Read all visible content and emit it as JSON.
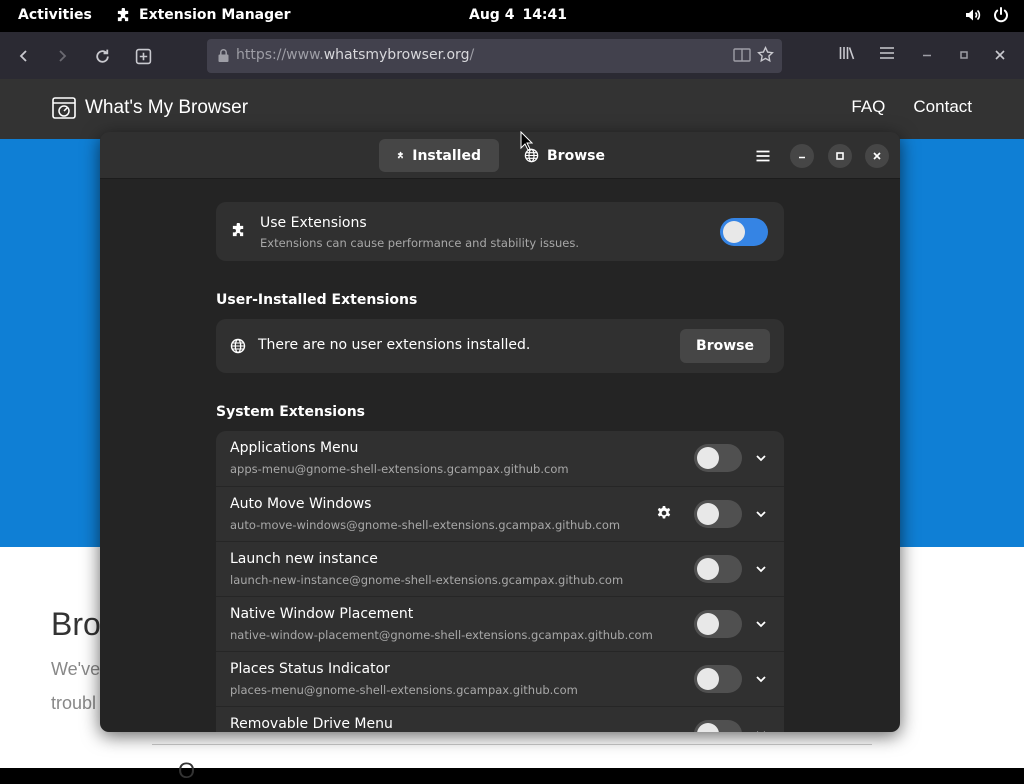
{
  "topbar": {
    "activities": "Activities",
    "app_name": "Extension Manager",
    "date": "Aug 4",
    "time": "14:41"
  },
  "browser": {
    "url_prefix": "https://www.",
    "url_domain": "whatsmybrowser.org",
    "url_suffix": "/"
  },
  "website": {
    "brand": "What's My Browser",
    "nav": [
      "FAQ",
      "Contact"
    ],
    "heading_partial": "Bro",
    "para_line1": "We've",
    "para_line2": "troubl",
    "bottom_partial": "O"
  },
  "extmgr": {
    "tabs": [
      {
        "label": "Installed",
        "icon": "puzzle-icon",
        "active": true
      },
      {
        "label": "Browse",
        "icon": "globe-icon",
        "active": false
      }
    ],
    "use_extensions": {
      "title": "Use Extensions",
      "subtitle": "Extensions can cause performance and stability issues.",
      "enabled": true
    },
    "user_section_title": "User-Installed Extensions",
    "no_user_ext": "There are no user extensions installed.",
    "browse_button": "Browse",
    "system_section_title": "System Extensions",
    "system_extensions": [
      {
        "name": "Applications Menu",
        "uuid": "apps-menu@gnome-shell-extensions.gcampax.github.com",
        "enabled": false,
        "has_settings": false
      },
      {
        "name": "Auto Move Windows",
        "uuid": "auto-move-windows@gnome-shell-extensions.gcampax.github.com",
        "enabled": false,
        "has_settings": true
      },
      {
        "name": "Launch new instance",
        "uuid": "launch-new-instance@gnome-shell-extensions.gcampax.github.com",
        "enabled": false,
        "has_settings": false
      },
      {
        "name": "Native Window Placement",
        "uuid": "native-window-placement@gnome-shell-extensions.gcampax.github.com",
        "enabled": false,
        "has_settings": false
      },
      {
        "name": "Places Status Indicator",
        "uuid": "places-menu@gnome-shell-extensions.gcampax.github.com",
        "enabled": false,
        "has_settings": false
      },
      {
        "name": "Removable Drive Menu",
        "uuid": "",
        "enabled": false,
        "has_settings": false
      }
    ]
  }
}
